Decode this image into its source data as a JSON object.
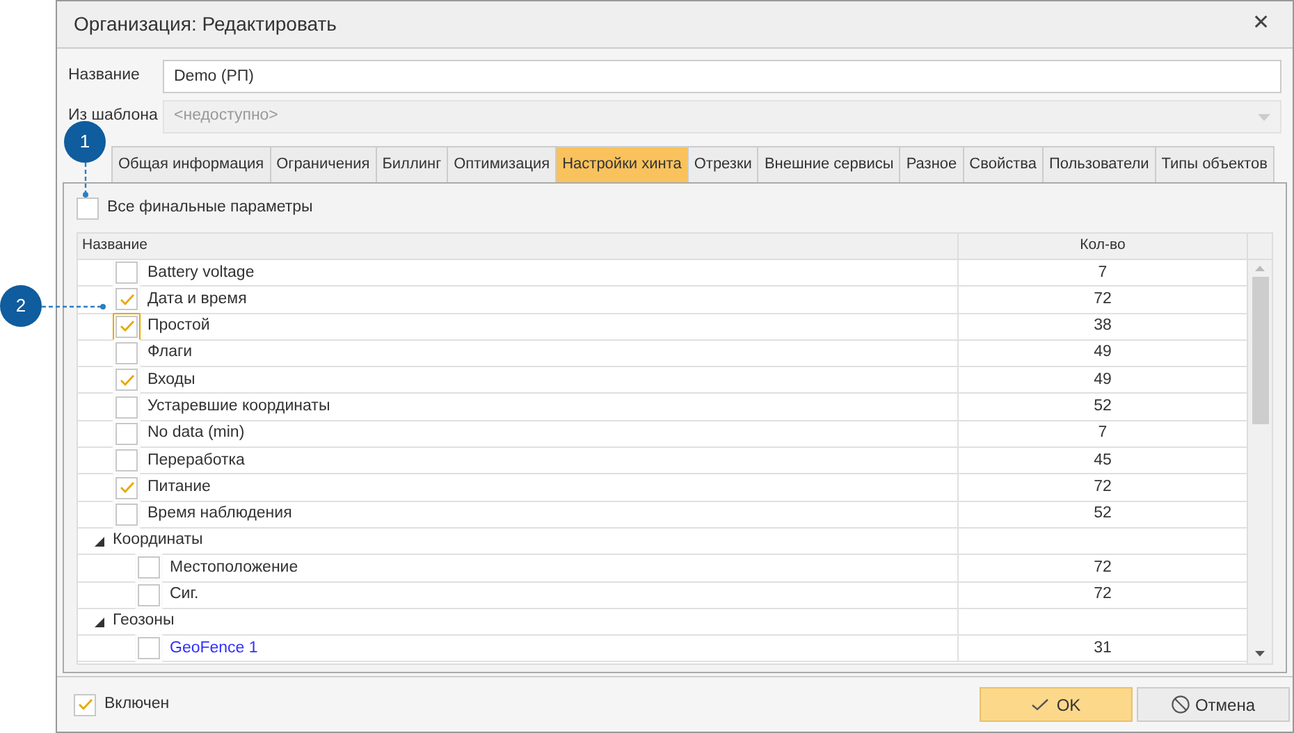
{
  "window": {
    "title": "Организация: Редактировать",
    "close": "✕"
  },
  "form": {
    "name_label": "Название",
    "name_value": "Demo (РП)",
    "template_label": "Из шаблона",
    "template_placeholder": "<недоступно>",
    "template_disabled": true
  },
  "tabs": [
    {
      "label": "Общая информация",
      "selected": false
    },
    {
      "label": "Ограничения",
      "selected": false
    },
    {
      "label": "Биллинг",
      "selected": false
    },
    {
      "label": "Оптимизация",
      "selected": false
    },
    {
      "label": "Настройки хинта",
      "selected": true
    },
    {
      "label": "Отрезки",
      "selected": false
    },
    {
      "label": "Внешние сервисы",
      "selected": false
    },
    {
      "label": "Разное",
      "selected": false
    },
    {
      "label": "Свойства",
      "selected": false
    },
    {
      "label": "Пользователи",
      "selected": false
    },
    {
      "label": "Типы объектов",
      "selected": false
    }
  ],
  "all_final": {
    "label": "Все финальные параметры",
    "checked": false
  },
  "table": {
    "columns": [
      "Название",
      "Кол-во"
    ],
    "rows": [
      {
        "kind": "item",
        "name": "Battery voltage",
        "count": "7",
        "checked": false,
        "focused": false
      },
      {
        "kind": "item",
        "name": "Дата и время",
        "count": "72",
        "checked": true,
        "focused": false
      },
      {
        "kind": "item",
        "name": "Простой",
        "count": "38",
        "checked": true,
        "focused": true
      },
      {
        "kind": "item",
        "name": "Флаги",
        "count": "49",
        "checked": false,
        "focused": false
      },
      {
        "kind": "item",
        "name": "Входы",
        "count": "49",
        "checked": true,
        "focused": false
      },
      {
        "kind": "item",
        "name": "Устаревшие координаты",
        "count": "52",
        "checked": false,
        "focused": false
      },
      {
        "kind": "item",
        "name": "No data (min)",
        "count": "7",
        "checked": false,
        "focused": false
      },
      {
        "kind": "item",
        "name": "Переработка",
        "count": "45",
        "checked": false,
        "focused": false
      },
      {
        "kind": "item",
        "name": "Питание",
        "count": "72",
        "checked": true,
        "focused": false
      },
      {
        "kind": "item",
        "name": "Время наблюдения",
        "count": "52",
        "checked": false,
        "focused": false
      },
      {
        "kind": "group",
        "name": "Координаты",
        "expanded": true,
        "children": [
          {
            "kind": "item",
            "name": "Местоположение",
            "count": "72",
            "checked": false,
            "focused": false
          },
          {
            "kind": "item",
            "name": "Сиг.",
            "count": "72",
            "checked": false,
            "focused": false
          }
        ]
      },
      {
        "kind": "group",
        "name": "Геозоны",
        "expanded": true,
        "children": [
          {
            "kind": "link",
            "name": "GeoFence 1",
            "count": "31",
            "checked": false,
            "focused": false
          }
        ]
      }
    ]
  },
  "footer": {
    "enabled_label": "Включен",
    "enabled_checked": true,
    "ok": "OK",
    "cancel": "Отмена"
  },
  "callouts": [
    {
      "label": "1",
      "kind": "vertical"
    },
    {
      "label": "2",
      "kind": "horizontal"
    }
  ]
}
